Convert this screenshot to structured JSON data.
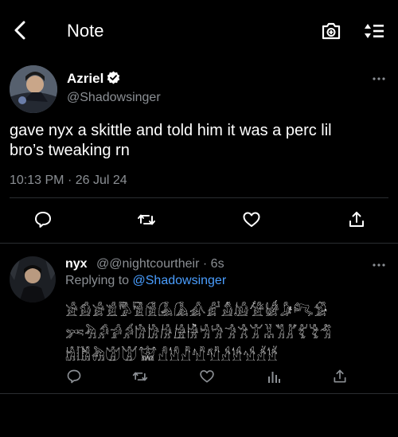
{
  "header": {
    "title": "Note"
  },
  "tweet": {
    "author_name": "Azriel",
    "author_handle": "@Shadowsinger",
    "text_line1": "gave nyx a skittle and told him it was a perc lil",
    "text_line2": "bro’s tweaking rn",
    "time": "10:13 PM",
    "separator": "·",
    "date": "26 Jul 24"
  },
  "reply": {
    "author_name": "nyx",
    "author_handle": "@@nightcourtheir",
    "separator": "·",
    "age": "6s",
    "replying_prefix": "Replying to",
    "replying_to": "@Shadowsinger",
    "glyph_line1": "𓀀𓀁𓀂𓀃𓀄𓀅𓀆𓀇𓀈𓀉𓀊𓀋𓀌𓀍𓀎𓀏𓀐𓀑",
    "glyph_line2": "𓀒𓀓𓀔𓀕𓀖𓀗𓀘𓀙𓀚𓀛𓀜𓀝𓀞𓀟𓀠𓀡𓀢𓀣𓀤𓀥𓀦",
    "glyph_line3": "𓀧𓀨𓀩𓀪𓀫𓀬𓀭𓀮𓀯𓀰𓀱𓀲𓀳𓀴𓀵𓀶"
  },
  "colors": {
    "background": "#000000",
    "text": "#ffffff",
    "muted": "#8b8f94",
    "link": "#4a9eff",
    "divider": "#2a2d31"
  },
  "icons": {
    "back": "chevron-left-icon",
    "camera": "camera-plus-icon",
    "sort": "sort-lines-icon",
    "verified": "verified-badge-icon",
    "more": "more-horizontal-icon",
    "reply": "comment-icon",
    "retweet": "retweet-icon",
    "like": "heart-icon",
    "share": "share-icon",
    "analytics": "analytics-icon"
  }
}
